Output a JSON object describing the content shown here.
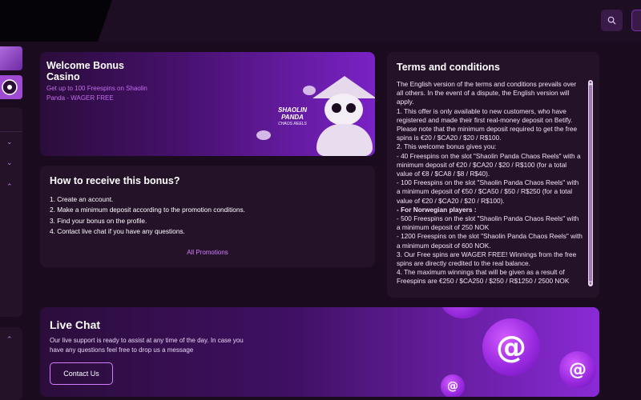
{
  "welcome": {
    "title": "Welcome Bonus Casino",
    "subtitle": "Get up to 100 Freespins on Shaolin Panda - WAGER FREE",
    "game_logo_line1": "SHAOLIN",
    "game_logo_line2": "PANDA",
    "game_logo_line3": "CHAOS REELS"
  },
  "howto": {
    "title": "How to receive this bonus?",
    "steps": [
      "1. Create an account.",
      "2. Make a minimum deposit according to the promotion conditions.",
      "3. Find your bonus on the profile.",
      "4. Contact live chat if you have any questions."
    ],
    "all_promotions": "All Promotions"
  },
  "terms": {
    "title": "Terms and conditions",
    "lines": [
      "The English version of the terms and conditions prevails over all others. In the event of a dispute, the English version will apply.",
      "1. This offer is only available to new customers, who have registered and made their first real-money deposit on Betify.",
      "Please note that the minimum deposit required to get the free spins is €20 / $CA20 / $20 / R$100.",
      "2. This welcome bonus gives you:",
      "- 40 Freespins on the slot \"Shaolin Panda Chaos Reels\" with a minimum deposit of €20 / $CA20 / $20 / R$100 (for a total value of €8 / $CA8 / $8 / R$40).",
      "- 100 Freespins on the slot \"Shaolin Panda Chaos Reels\" with a minimum deposit of €50 / $CA50 / $50 / R$250 (for a total value of €20 / $CA20 / $20 / R$100).",
      "- For Norwegian players :",
      "- 500 Freespins on the slot \"Shaolin Panda Chaos Reels\" with a minimum deposit of 250 NOK",
      "- 1200 Freespins on the slot \"Shaolin Panda Chaos Reels\" with a minimum deposit of 600 NOK.",
      "3. Our Free spins are WAGER FREE! Winnings from the free spins are directly credited to the real balance.",
      "4. The maximum winnings that will be given as a result of Freespins are €250 / $CA250 / $250 / R$1250 / 2500 NOK"
    ]
  },
  "livechat": {
    "title": "Live Chat",
    "description": "Our live support is ready to assist at any time of the day. In case you have any questions feel free to drop us a message",
    "button": "Contact Us",
    "bubble_symbol": "@"
  },
  "icons": {
    "search": "search-icon",
    "chevrons": [
      "chevron-down-icon",
      "chevron-down-icon",
      "chevron-up-icon",
      "chevron-up-icon"
    ]
  },
  "colors": {
    "accent": "#d27cff",
    "page_bg": "#1a0b1f",
    "card_bg": "#241229"
  }
}
